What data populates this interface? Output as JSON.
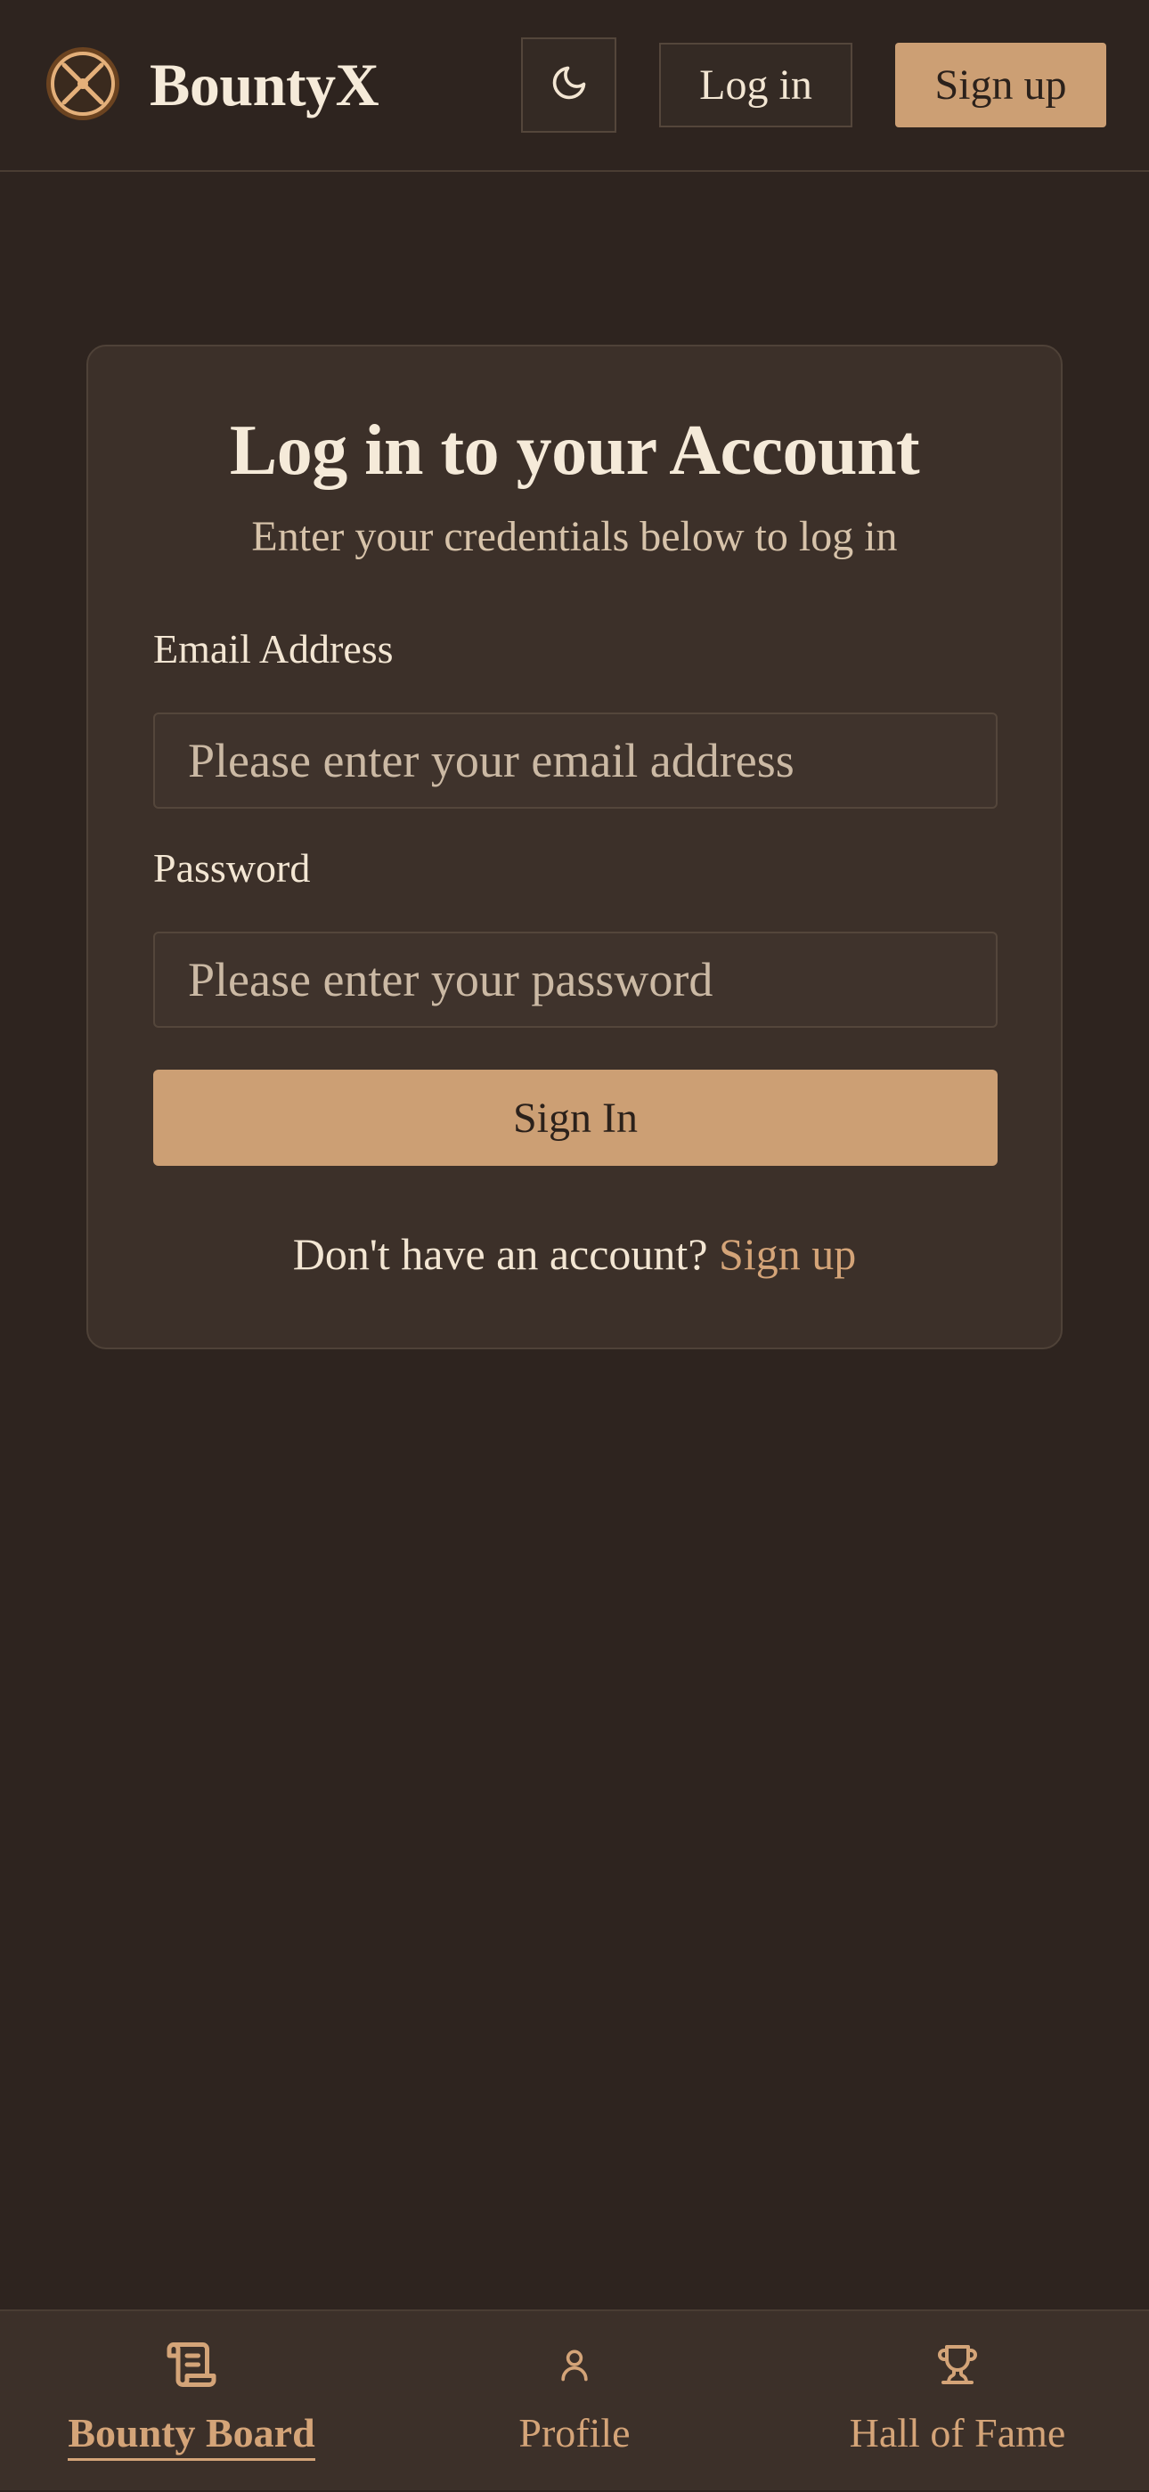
{
  "header": {
    "brand": "BountyX",
    "login_label": "Log in",
    "signup_label": "Sign up",
    "theme_icon": "moon-icon",
    "logo_icon": "crosshair-logo-icon"
  },
  "login_card": {
    "title": "Log in to your Account",
    "subtitle": "Enter your credentials below to log in",
    "email_label": "Email Address",
    "email_placeholder": "Please enter your email address",
    "email_value": "",
    "password_label": "Password",
    "password_placeholder": "Please enter your password",
    "password_value": "",
    "submit_label": "Sign In",
    "footer_prompt": "Don't have an account? ",
    "footer_link": "Sign up"
  },
  "bottom_nav": {
    "items": [
      {
        "label": "Bounty Board",
        "icon": "scroll-icon",
        "active": true
      },
      {
        "label": "Profile",
        "icon": "user-icon",
        "active": false
      },
      {
        "label": "Hall of Fame",
        "icon": "trophy-icon",
        "active": false
      }
    ]
  },
  "colors": {
    "background": "#2e241f",
    "card": "#3c3029",
    "accent": "#cc9f74",
    "link": "#d4a478",
    "text": "#f3e6d3"
  }
}
